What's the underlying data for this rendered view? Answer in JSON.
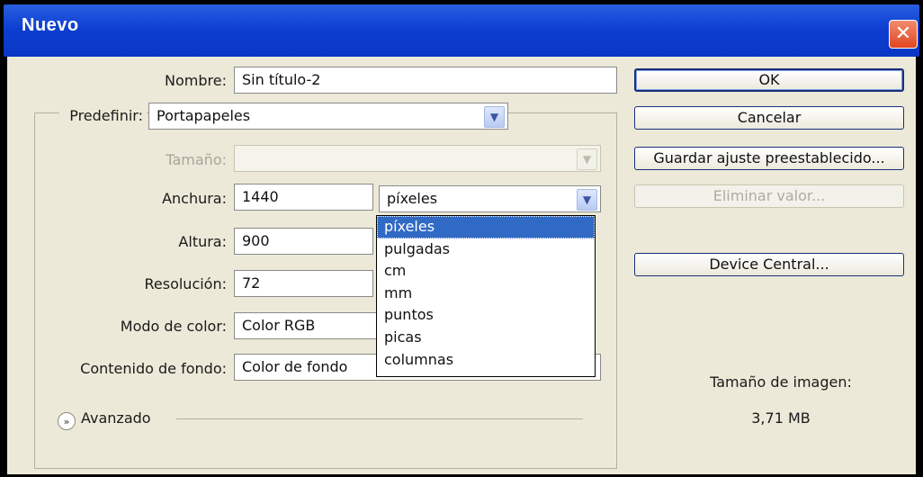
{
  "window": {
    "title": "Nuevo"
  },
  "form": {
    "nombre": {
      "label": "Nombre:",
      "value": "Sin título-2"
    },
    "predefinir": {
      "label": "Predefinir:",
      "value": "Portapapeles"
    },
    "tamano": {
      "label": "Tamaño:",
      "value": ""
    },
    "anchura": {
      "label": "Anchura:",
      "value": "1440",
      "unit": "píxeles"
    },
    "altura": {
      "label": "Altura:",
      "value": "900"
    },
    "resolucion": {
      "label": "Resolución:",
      "value": "72"
    },
    "modo_color": {
      "label": "Modo de color:",
      "value": "Color RGB"
    },
    "contenido_fondo": {
      "label": "Contenido de fondo:",
      "value": "Color de fondo"
    },
    "avanzado": {
      "label": "Avanzado"
    }
  },
  "unit_options": [
    "píxeles",
    "pulgadas",
    "cm",
    "mm",
    "puntos",
    "picas",
    "columnas"
  ],
  "buttons": {
    "ok": "OK",
    "cancel": "Cancelar",
    "save_preset": "Guardar ajuste preestablecido...",
    "delete_preset": "Eliminar valor...",
    "device_central": "Device Central..."
  },
  "image_size": {
    "label": "Tamaño de imagen:",
    "value": "3,71 MB"
  },
  "icons": {
    "close": "close-icon",
    "dropdown": "chevron-down-icon",
    "advanced": "double-chevron-down-icon"
  },
  "colors": {
    "titlebar": "#0d3fd2",
    "dialog_bg": "#ece9d8",
    "selection": "#316ac5",
    "close_button": "#e0461f"
  }
}
